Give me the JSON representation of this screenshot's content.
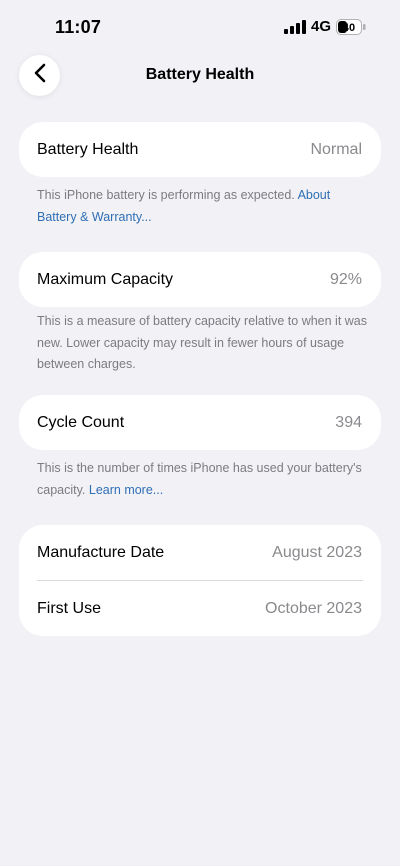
{
  "status_bar": {
    "time": "11:07",
    "network": "4G",
    "battery_level": "40"
  },
  "nav": {
    "title": "Battery Health"
  },
  "battery_health": {
    "label": "Battery Health",
    "value": "Normal",
    "note": "This iPhone battery is performing as expected. ",
    "note_link": "About Battery & Warranty..."
  },
  "maximum_capacity": {
    "label": "Maximum Capacity",
    "value": "92%",
    "note": "This is a measure of battery capacity relative to when it was new. Lower capacity may result in fewer hours of usage between charges."
  },
  "cycle_count": {
    "label": "Cycle Count",
    "value": "394",
    "note": "This is the number of times iPhone has used your battery's capacity. ",
    "note_link": "Learn more..."
  },
  "dates": {
    "manufacture_label": "Manufacture Date",
    "manufacture_value": "August 2023",
    "first_use_label": "First Use",
    "first_use_value": "October 2023"
  },
  "colors": {
    "background": "#f1f1f6",
    "card": "#ffffff",
    "link": "#2f6fb5",
    "secondary_text": "#8a8a8e"
  }
}
